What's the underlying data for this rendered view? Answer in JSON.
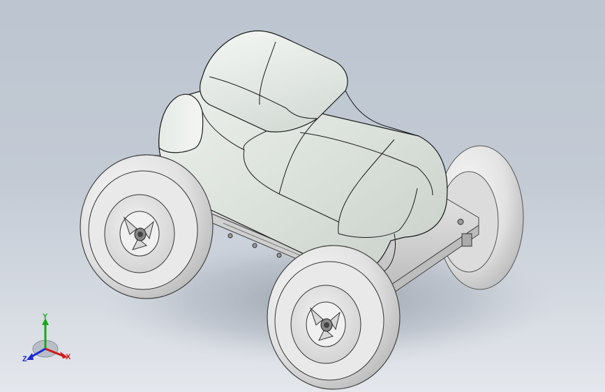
{
  "viewport": {
    "background_top": "#bcc5d0",
    "background_bottom": "#e4e7ec"
  },
  "model": {
    "body_color": "#dfe4df",
    "tire_color": "#e6e6e6",
    "chassis_color": "#e8e8e8"
  },
  "triad": {
    "x_label": "X",
    "y_label": "Y",
    "z_label": "Z",
    "x_color": "#d01818",
    "y_color": "#1aa81a",
    "z_color": "#1a2ad0"
  }
}
